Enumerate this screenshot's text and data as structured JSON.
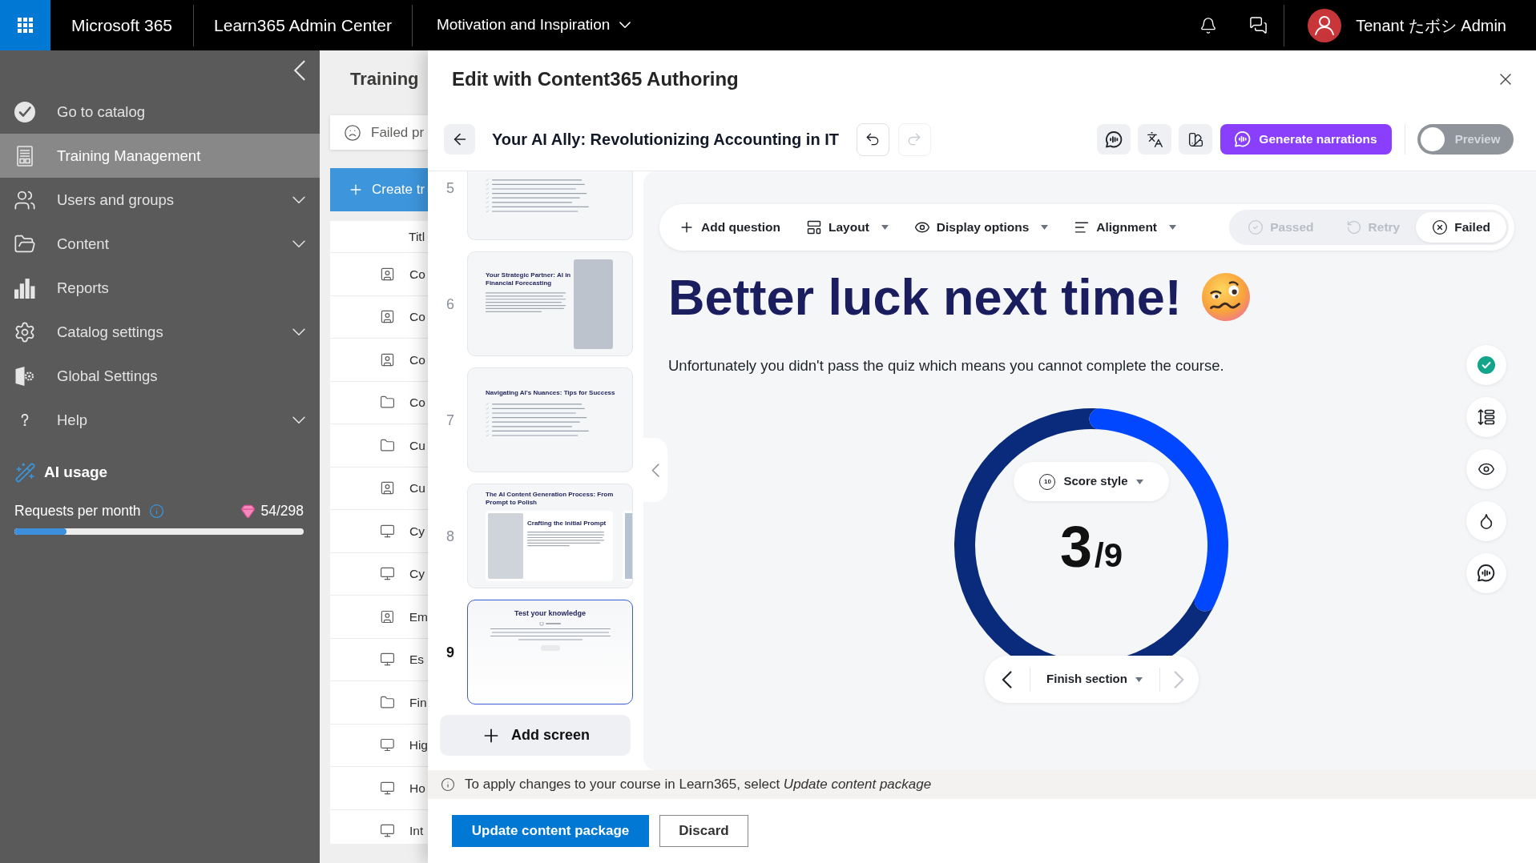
{
  "top_bar": {
    "product": "Microsoft 365",
    "app": "Learn365 Admin Center",
    "workspace": "Motivation and Inspiration",
    "user": "Tenant たボシ Admin"
  },
  "sidebar": {
    "items": [
      {
        "label": "Go to catalog",
        "kind": "link",
        "selected": false
      },
      {
        "label": "Training Management",
        "kind": "link",
        "selected": true
      },
      {
        "label": "Users and groups",
        "kind": "group",
        "selected": false
      },
      {
        "label": "Content",
        "kind": "group",
        "selected": false
      },
      {
        "label": "Reports",
        "kind": "link",
        "selected": false
      },
      {
        "label": "Catalog settings",
        "kind": "group",
        "selected": false
      },
      {
        "label": "Global Settings",
        "kind": "link",
        "selected": false
      },
      {
        "label": "Help",
        "kind": "group",
        "selected": false
      }
    ],
    "ai_usage": {
      "title": "AI usage",
      "label": "Requests per month",
      "count": "54/298",
      "level": 0.18
    }
  },
  "background_page": {
    "title": "Training",
    "filter": "Failed pr",
    "create_button": "Create tr",
    "column_1": "Titl",
    "rows": [
      {
        "kind": "classroom",
        "text": "Co"
      },
      {
        "kind": "classroom",
        "text": "Co"
      },
      {
        "kind": "classroom",
        "text": "Co"
      },
      {
        "kind": "folder",
        "text": "Co"
      },
      {
        "kind": "folder",
        "text": "Cu"
      },
      {
        "kind": "classroom",
        "text": "Cu"
      },
      {
        "kind": "screen",
        "text": "Cy"
      },
      {
        "kind": "screen",
        "text": "Cy"
      },
      {
        "kind": "classroom",
        "text": "Em"
      },
      {
        "kind": "screen",
        "text": "Es"
      },
      {
        "kind": "folder",
        "text": "Fin"
      },
      {
        "kind": "screen",
        "text": "Hig"
      },
      {
        "kind": "screen",
        "text": "Ho"
      },
      {
        "kind": "screen",
        "text": "Int"
      }
    ]
  },
  "editor": {
    "title": "Edit with Content365 Authoring",
    "course_title": "Your AI Ally: Revolutionizing Accounting in IT",
    "history": [
      {
        "kind": "undo",
        "disabled": false
      },
      {
        "kind": "redo",
        "disabled": true
      }
    ],
    "narrations_button": "Generate narrations",
    "preview": {
      "label": "Preview",
      "on": false
    },
    "slides": [
      {
        "number": "5",
        "kind": "checklist",
        "selected": false
      },
      {
        "number": "6",
        "kind": "image",
        "title": "Your Strategic Partner: AI in Financial Forecasting",
        "selected": false
      },
      {
        "number": "7",
        "kind": "checklist",
        "title": "Navigating AI's Nuances: Tips for Success",
        "selected": false
      },
      {
        "number": "8",
        "kind": "cards",
        "title": "The AI Content Generation Process: From Prompt to Polish",
        "card_title": "Crafting the Initial Prompt",
        "selected": false
      },
      {
        "number": "9",
        "kind": "quiz",
        "title": "Test your knowledge",
        "selected": true
      }
    ],
    "add_screen": "Add screen",
    "toolbar": [
      {
        "label": "Add question",
        "kind": "action"
      },
      {
        "label": "Layout",
        "kind": "menu"
      },
      {
        "label": "Display options",
        "kind": "menu"
      },
      {
        "label": "Alignment",
        "kind": "menu"
      }
    ],
    "outcomes": [
      {
        "label": "Passed",
        "selected": false
      },
      {
        "label": "Retry",
        "selected": false
      },
      {
        "label": "Failed",
        "selected": true
      }
    ],
    "screen": {
      "heading": "Better luck next time!",
      "message": "Unfortunately you didn't pass the quiz which means you cannot complete the course.",
      "score": {
        "style_label": "Score style",
        "style_icon": "10",
        "value": "3",
        "total": "/9",
        "chart_data": {
          "type": "donut",
          "values": [
            33.3,
            66.7
          ]
        }
      },
      "navigation": {
        "label": "Finish section",
        "previous_disabled": false,
        "next_disabled": true
      }
    },
    "notice": "To apply changes to your course in Learn365, select *Update content package*",
    "buttons": [
      {
        "label": "Update content package",
        "kind": "primary"
      },
      {
        "label": "Discard",
        "kind": "secondary"
      }
    ]
  }
}
